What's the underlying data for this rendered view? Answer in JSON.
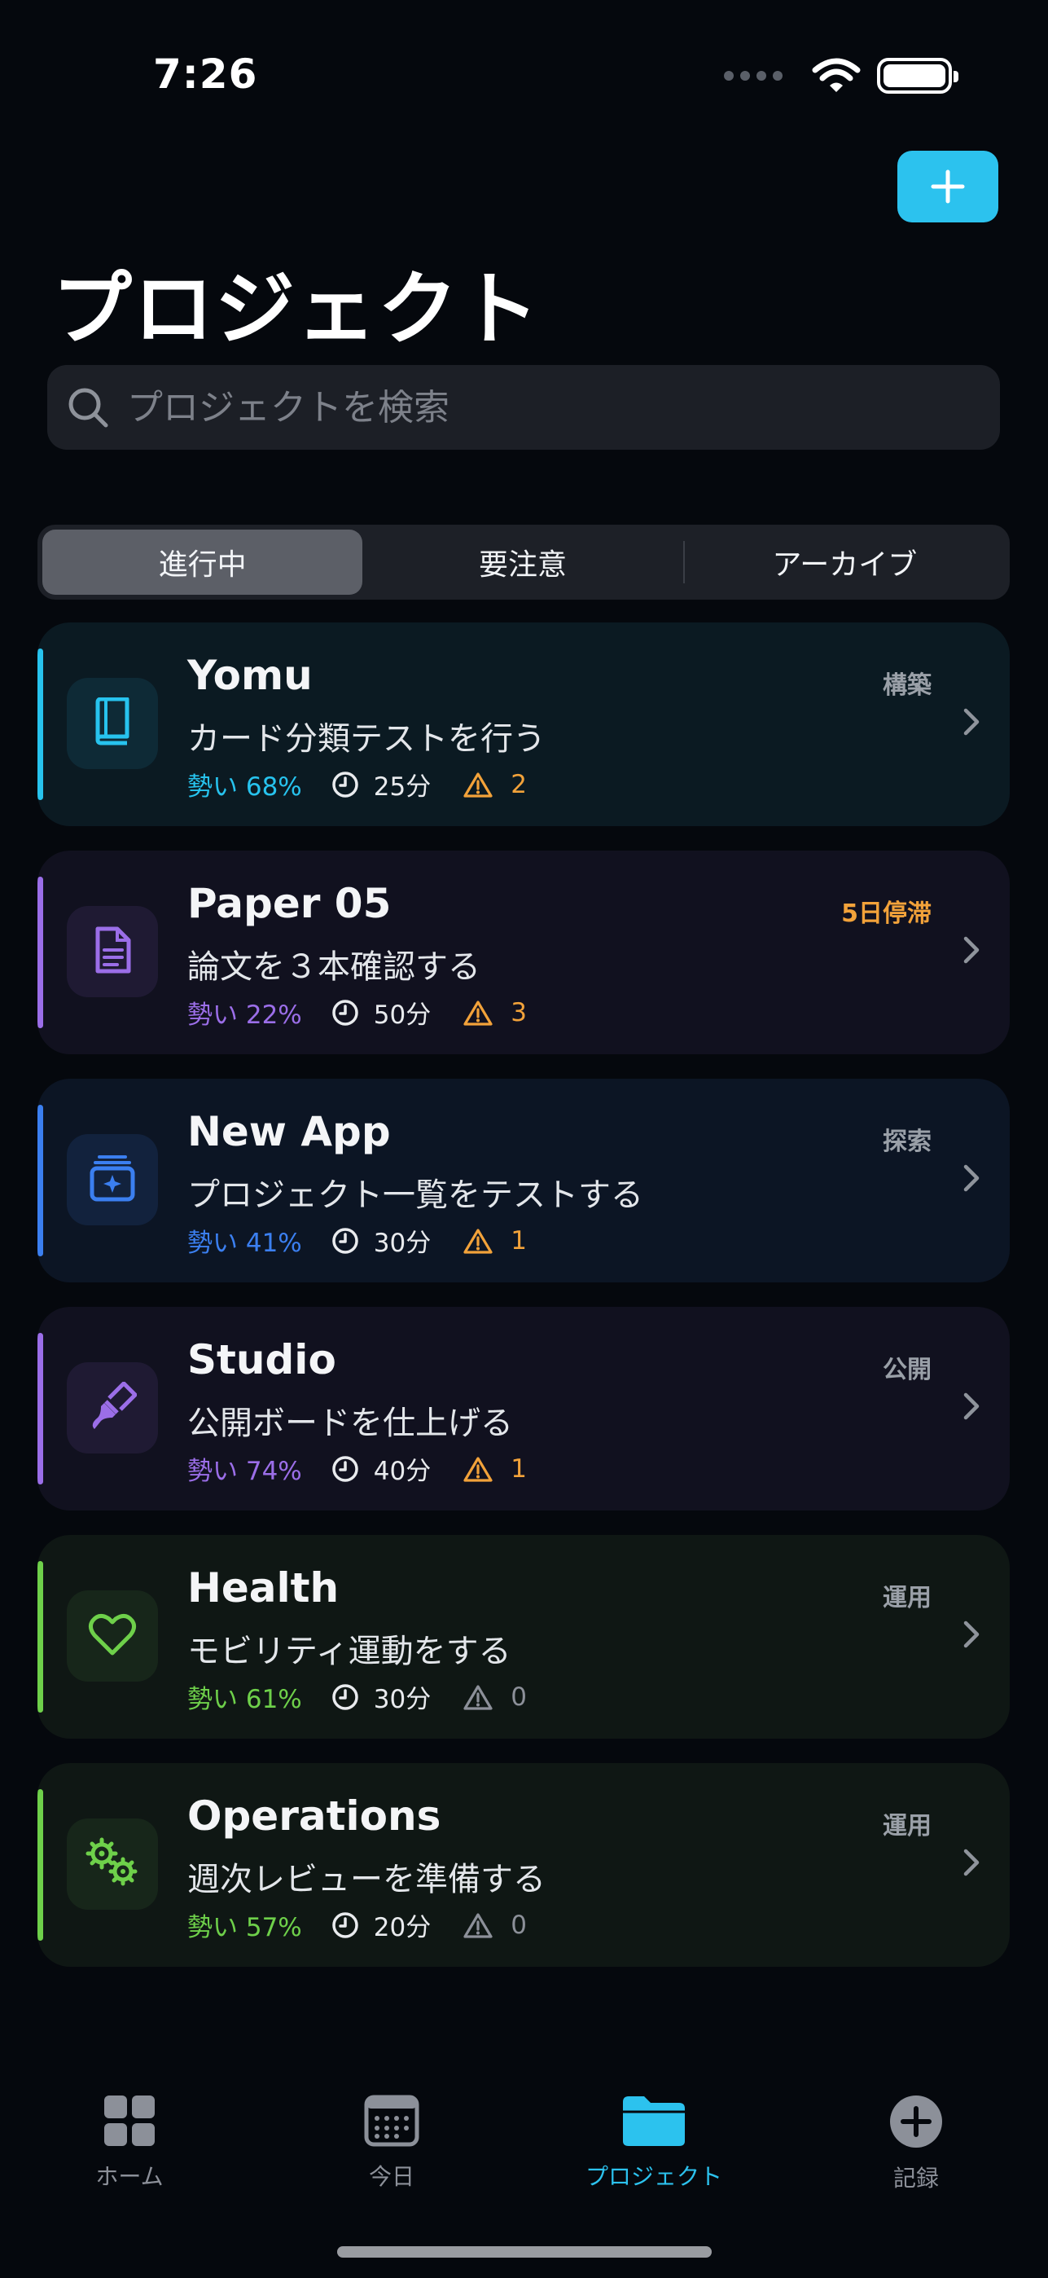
{
  "status_bar": {
    "time": "7:26"
  },
  "header": {
    "title": "プロジェクト"
  },
  "search": {
    "placeholder": "プロジェクトを検索"
  },
  "segments": [
    {
      "label": "進行中",
      "active": true
    },
    {
      "label": "要注意",
      "active": false
    },
    {
      "label": "アーカイブ",
      "active": false
    }
  ],
  "projects": [
    {
      "name": "Yomu",
      "phase": "構築",
      "task": "カード分類テストを行う",
      "momentum": "勢い 68%",
      "time": "25分",
      "warnings": "2",
      "icon": "book-icon",
      "accent": "#27c3ee",
      "bg": "#0b1a22",
      "icon_bg": "#0e2a36",
      "phase_color": "#9aa0a8"
    },
    {
      "name": "Paper 05",
      "phase": "5日停滞",
      "task": "論文を３本確認する",
      "momentum": "勢い 22%",
      "time": "50分",
      "warnings": "3",
      "icon": "document-icon",
      "accent": "#9b6ee8",
      "bg": "#11111f",
      "icon_bg": "#1f1a33",
      "phase_color": "#f2a23a"
    },
    {
      "name": "New App",
      "phase": "探索",
      "task": "プロジェクト一覧をテストする",
      "momentum": "勢い 41%",
      "time": "30分",
      "warnings": "1",
      "icon": "app-stack-icon",
      "accent": "#3b7ff0",
      "bg": "#0c1524",
      "icon_bg": "#12223d",
      "phase_color": "#9aa0a8"
    },
    {
      "name": "Studio",
      "phase": "公開",
      "task": "公開ボードを仕上げる",
      "momentum": "勢い 74%",
      "time": "40分",
      "warnings": "1",
      "icon": "paintbrush-icon",
      "accent": "#9b6ee8",
      "bg": "#11111f",
      "icon_bg": "#1f1a33",
      "phase_color": "#9aa0a8"
    },
    {
      "name": "Health",
      "phase": "運用",
      "task": "モビリティ運動をする",
      "momentum": "勢い 61%",
      "time": "30分",
      "warnings": "0",
      "icon": "heart-icon",
      "accent": "#6ed04a",
      "bg": "#0f1714",
      "icon_bg": "#17261a",
      "phase_color": "#9aa0a8"
    },
    {
      "name": "Operations",
      "phase": "運用",
      "task": "週次レビューを準備する",
      "momentum": "勢い 57%",
      "time": "20分",
      "warnings": "0",
      "icon": "gears-icon",
      "accent": "#6ed04a",
      "bg": "#0f1714",
      "icon_bg": "#17261a",
      "phase_color": "#9aa0a8"
    }
  ],
  "tabs": [
    {
      "label": "ホーム",
      "icon": "grid-icon",
      "active": false
    },
    {
      "label": "今日",
      "icon": "calendar-icon",
      "active": false
    },
    {
      "label": "プロジェクト",
      "icon": "folder-icon",
      "active": true
    },
    {
      "label": "記録",
      "icon": "plus-circle-icon",
      "active": false
    }
  ],
  "colors": {
    "accent": "#2cc2ee",
    "warning": "#f2a23a",
    "muted": "#8c9099"
  }
}
